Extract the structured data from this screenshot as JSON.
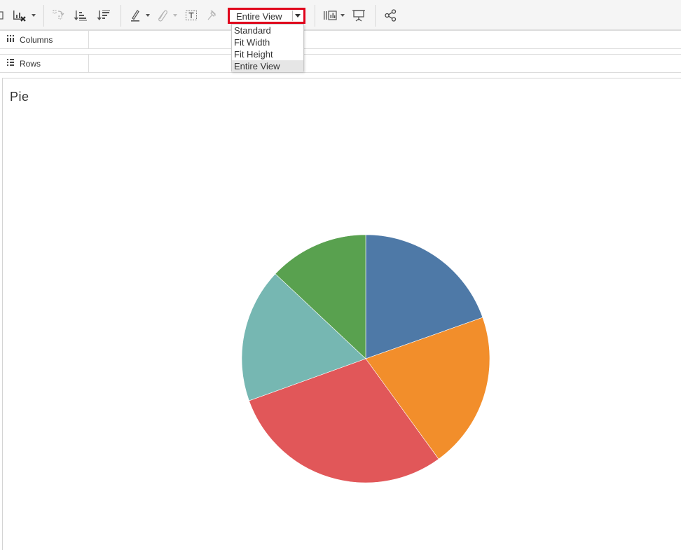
{
  "toolbar": {
    "fit": {
      "value": "Entire View",
      "options": [
        "Standard",
        "Fit Width",
        "Fit Height",
        "Entire View"
      ],
      "selected_index": 3
    }
  },
  "shelves": {
    "columns_label": "Columns",
    "rows_label": "Rows"
  },
  "sheet": {
    "title": "Pie"
  },
  "chart_data": {
    "type": "pie",
    "title": "Pie",
    "start_angle_deg": 0,
    "direction": "clockwise",
    "slices": [
      {
        "value": 19.6,
        "color": "#4e79a7"
      },
      {
        "value": 20.4,
        "color": "#f28e2b"
      },
      {
        "value": 29.5,
        "color": "#e15759"
      },
      {
        "value": 17.5,
        "color": "#76b7b2"
      },
      {
        "value": 13.0,
        "color": "#59a14f"
      }
    ]
  }
}
